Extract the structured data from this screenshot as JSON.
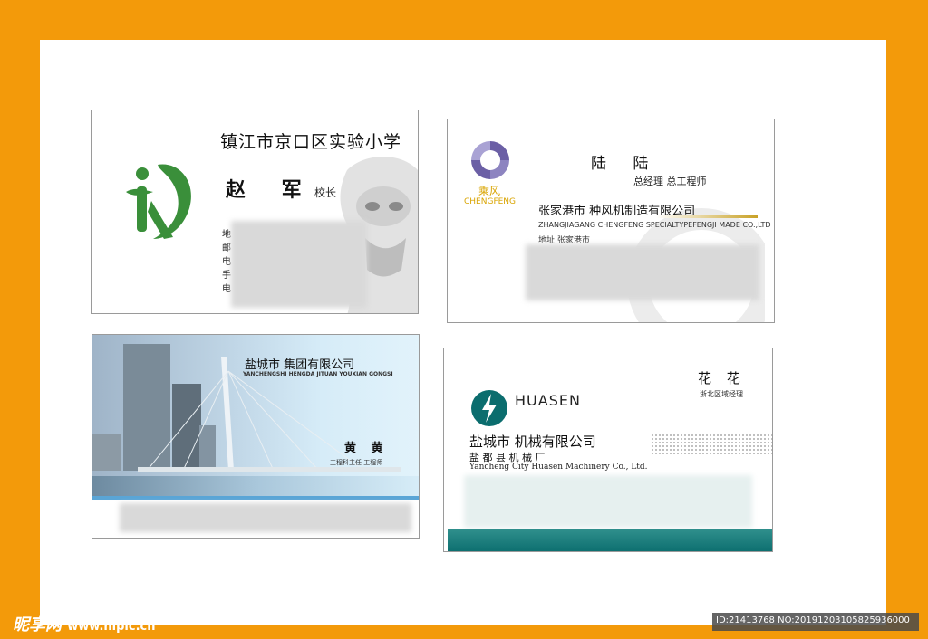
{
  "colors": {
    "frame": "#f39a0a",
    "green": "#3a8f3a",
    "teal": "#0b6d6e",
    "gold": "#d9a400",
    "purple": "#6b5fa5"
  },
  "card1": {
    "school": "镇江市京口区实验小学",
    "name": "赵 军",
    "title": "校长",
    "labels": [
      "地",
      "邮",
      "电",
      "手",
      "电"
    ]
  },
  "card2": {
    "name": "陆 陆",
    "title": "总经理  总工程师",
    "brand_cn": "乘风",
    "brand_en": "CHENGFENG",
    "company": "张家港市          种风机制造有限公司",
    "company_en": "ZHANGJIAGANG CHENGFENG SPECIALTYPEFENGJI MADE CO.,LTD",
    "address": "地址    张家港市"
  },
  "card3": {
    "company": "盐城市          集团有限公司",
    "company_en": "YANCHENGSHI HENGDA JITUAN YOUXIAN GONGSI",
    "name": "黄 黄",
    "title": "工程科主任  工程师"
  },
  "card4": {
    "name": "花 花",
    "title": "浙北区域经理",
    "brand": "HUASEN",
    "company": "盐城市        机械有限公司",
    "sub": "盐 都 县                  机 械 厂",
    "company_en": "Yancheng City Huasen Machinery Co., Ltd."
  },
  "watermark": {
    "logo": "昵享网",
    "url": "www.nipic.cn"
  },
  "id_text": "ID:21413768 NO:20191203105825936000"
}
